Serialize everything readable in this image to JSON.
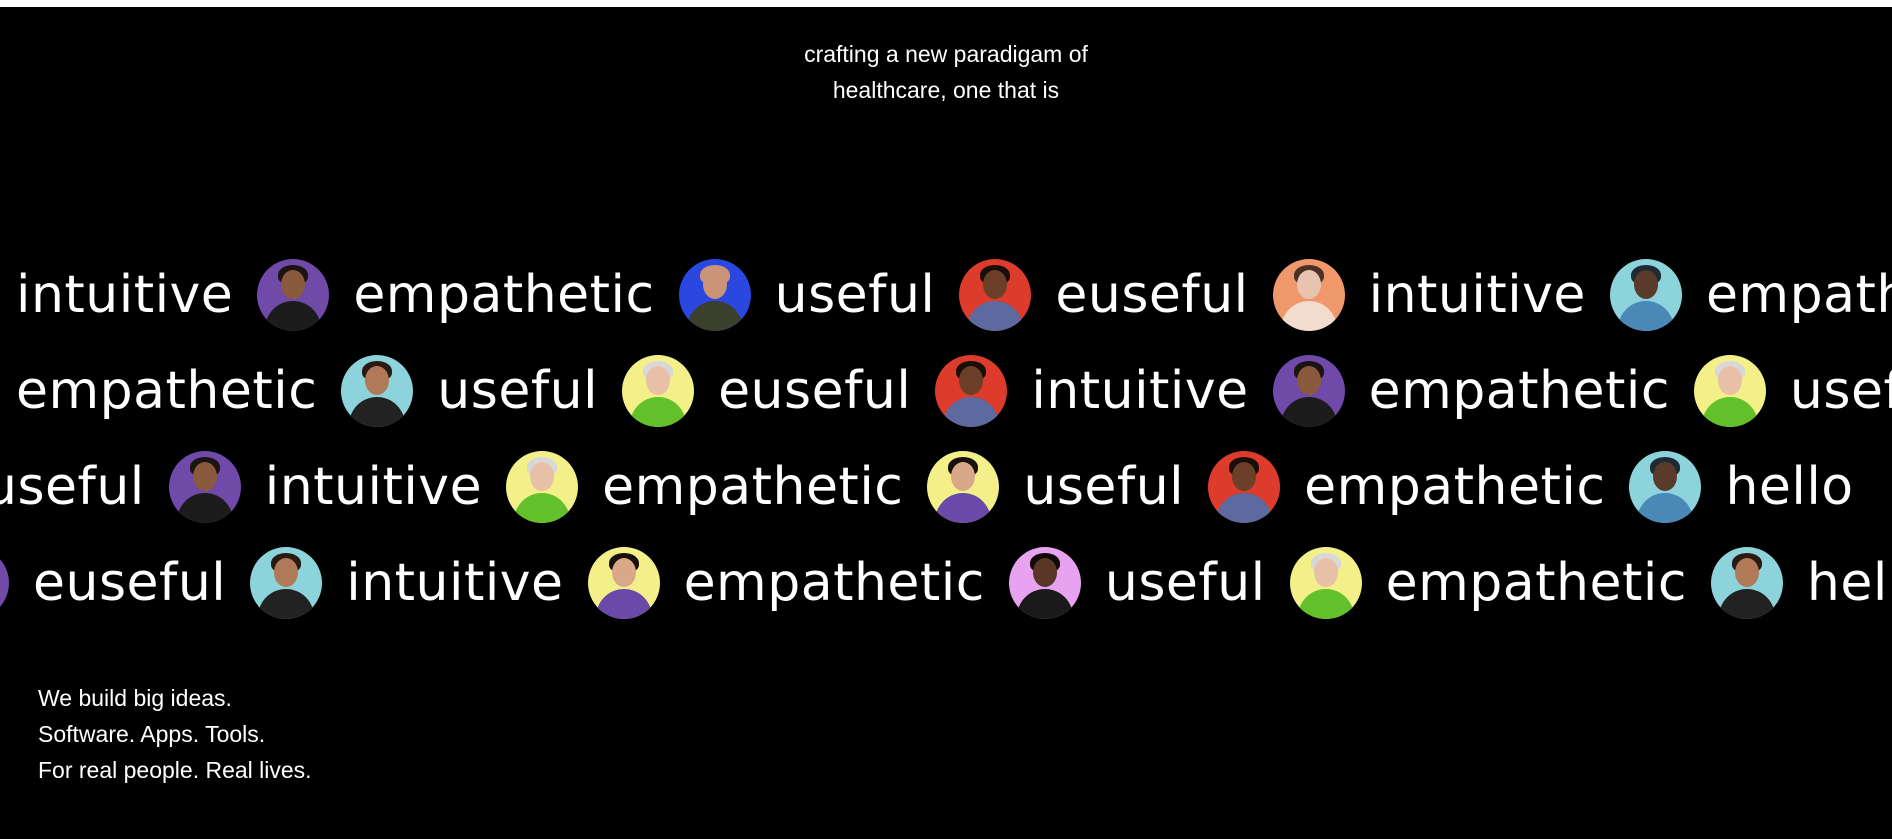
{
  "intro": {
    "line1": "crafting a new paradigam of",
    "line2": "healthcare, one that is"
  },
  "marquee_rows": [
    {
      "items": [
        {
          "kind": "word",
          "text": "intuitive"
        },
        {
          "kind": "avatar",
          "icon": "portrait-man-dark-jacket-icon",
          "bg": "#6f4aa8",
          "skin": "#8a5a3f",
          "hair": "#1b1410",
          "shirt": "#1c1c1c"
        },
        {
          "kind": "word",
          "text": "empathetic"
        },
        {
          "kind": "avatar",
          "icon": "portrait-man-glasses-icon",
          "bg": "#2a47e0",
          "skin": "#c99478",
          "hair": "#c99478",
          "shirt": "#3b3f2e"
        },
        {
          "kind": "word",
          "text": "useful"
        },
        {
          "kind": "avatar",
          "icon": "portrait-woman-floral-icon",
          "bg": "#dd3b2c",
          "skin": "#6b3f28",
          "hair": "#1a0e08",
          "shirt": "#5c6aa0"
        },
        {
          "kind": "word",
          "text": "euseful"
        },
        {
          "kind": "avatar",
          "icon": "portrait-woman-dark-hair-icon",
          "bg": "#f0986c",
          "skin": "#e8c4b0",
          "hair": "#4a3226",
          "shirt": "#f2dccd"
        },
        {
          "kind": "word",
          "text": "intuitive"
        },
        {
          "kind": "avatar",
          "icon": "portrait-man-hat-icon",
          "bg": "#8dd3dc",
          "skin": "#5a3a2a",
          "hair": "#1f2a35",
          "shirt": "#4a88b8"
        },
        {
          "kind": "word",
          "text": "empathetic"
        }
      ]
    },
    {
      "items": [
        {
          "kind": "word",
          "text": "empathetic"
        },
        {
          "kind": "avatar",
          "icon": "portrait-woman-long-hair-icon",
          "bg": "#8dd3dc",
          "skin": "#b07a58",
          "hair": "#2a1a12",
          "shirt": "#222"
        },
        {
          "kind": "word",
          "text": "useful"
        },
        {
          "kind": "avatar",
          "icon": "portrait-woman-grey-hair-icon",
          "bg": "#f3f08a",
          "skin": "#e8c0a8",
          "hair": "#d8d8d8",
          "shirt": "#62c12a"
        },
        {
          "kind": "word",
          "text": "euseful"
        },
        {
          "kind": "avatar",
          "icon": "portrait-woman-floral-icon",
          "bg": "#dd3b2c",
          "skin": "#6b3f28",
          "hair": "#1a0e08",
          "shirt": "#5c6aa0"
        },
        {
          "kind": "word",
          "text": "intuitive"
        },
        {
          "kind": "avatar",
          "icon": "portrait-man-dark-jacket-icon",
          "bg": "#6f4aa8",
          "skin": "#8a5a3f",
          "hair": "#1b1410",
          "shirt": "#1c1c1c"
        },
        {
          "kind": "word",
          "text": "empathetic"
        },
        {
          "kind": "avatar",
          "icon": "portrait-woman-grey-hair-icon",
          "bg": "#f3f08a",
          "skin": "#e8c0a8",
          "hair": "#d8d8d8",
          "shirt": "#62c12a"
        },
        {
          "kind": "word",
          "text": "useful"
        }
      ]
    },
    {
      "items": [
        {
          "kind": "word",
          "text": "useful"
        },
        {
          "kind": "avatar",
          "icon": "portrait-man-dark-jacket-icon",
          "bg": "#6f4aa8",
          "skin": "#8a5a3f",
          "hair": "#1b1410",
          "shirt": "#1c1c1c"
        },
        {
          "kind": "word",
          "text": "intuitive"
        },
        {
          "kind": "avatar",
          "icon": "portrait-woman-grey-hair-icon",
          "bg": "#f3f08a",
          "skin": "#e8c0a8",
          "hair": "#d8d8d8",
          "shirt": "#62c12a"
        },
        {
          "kind": "word",
          "text": "empathetic"
        },
        {
          "kind": "avatar",
          "icon": "portrait-woman-purple-jacket-icon",
          "bg": "#f3f08a",
          "skin": "#d9a888",
          "hair": "#1a1010",
          "shirt": "#6a4aa8"
        },
        {
          "kind": "word",
          "text": "useful"
        },
        {
          "kind": "avatar",
          "icon": "portrait-woman-floral-icon",
          "bg": "#dd3b2c",
          "skin": "#6b3f28",
          "hair": "#1a0e08",
          "shirt": "#5c6aa0"
        },
        {
          "kind": "word",
          "text": "empathetic"
        },
        {
          "kind": "avatar",
          "icon": "portrait-man-hat-icon",
          "bg": "#8dd3dc",
          "skin": "#5a3a2a",
          "hair": "#1f2a35",
          "shirt": "#4a88b8"
        },
        {
          "kind": "word",
          "text": "hello"
        }
      ]
    },
    {
      "items": [
        {
          "kind": "avatar",
          "icon": "portrait-man-dark-jacket-icon",
          "bg": "#6f4aa8",
          "skin": "#8a5a3f",
          "hair": "#1b1410",
          "shirt": "#1c1c1c"
        },
        {
          "kind": "word",
          "text": "euseful"
        },
        {
          "kind": "avatar",
          "icon": "portrait-woman-long-hair-icon",
          "bg": "#8dd3dc",
          "skin": "#b07a58",
          "hair": "#2a1a12",
          "shirt": "#222"
        },
        {
          "kind": "word",
          "text": "intuitive"
        },
        {
          "kind": "avatar",
          "icon": "portrait-woman-purple-jacket-icon",
          "bg": "#f3f08a",
          "skin": "#d9a888",
          "hair": "#1a1010",
          "shirt": "#6a4aa8"
        },
        {
          "kind": "word",
          "text": "empathetic"
        },
        {
          "kind": "avatar",
          "icon": "portrait-woman-curly-hair-icon",
          "bg": "#e7a3f0",
          "skin": "#5a3626",
          "hair": "#120a06",
          "shirt": "#1a1a1a"
        },
        {
          "kind": "word",
          "text": "useful"
        },
        {
          "kind": "avatar",
          "icon": "portrait-woman-grey-hair-icon",
          "bg": "#f3f08a",
          "skin": "#e8c0a8",
          "hair": "#d8d8d8",
          "shirt": "#62c12a"
        },
        {
          "kind": "word",
          "text": "empathetic"
        },
        {
          "kind": "avatar",
          "icon": "portrait-woman-long-hair-icon",
          "bg": "#8dd3dc",
          "skin": "#b07a58",
          "hair": "#2a1a12",
          "shirt": "#222"
        },
        {
          "kind": "word",
          "text": "hello"
        }
      ]
    }
  ],
  "tagline": {
    "line1": "We build big ideas.",
    "line2": "Software. Apps. Tools.",
    "line3": "For real people. Real lives."
  },
  "colors": {
    "background": "#000000",
    "text": "#ffffff"
  }
}
